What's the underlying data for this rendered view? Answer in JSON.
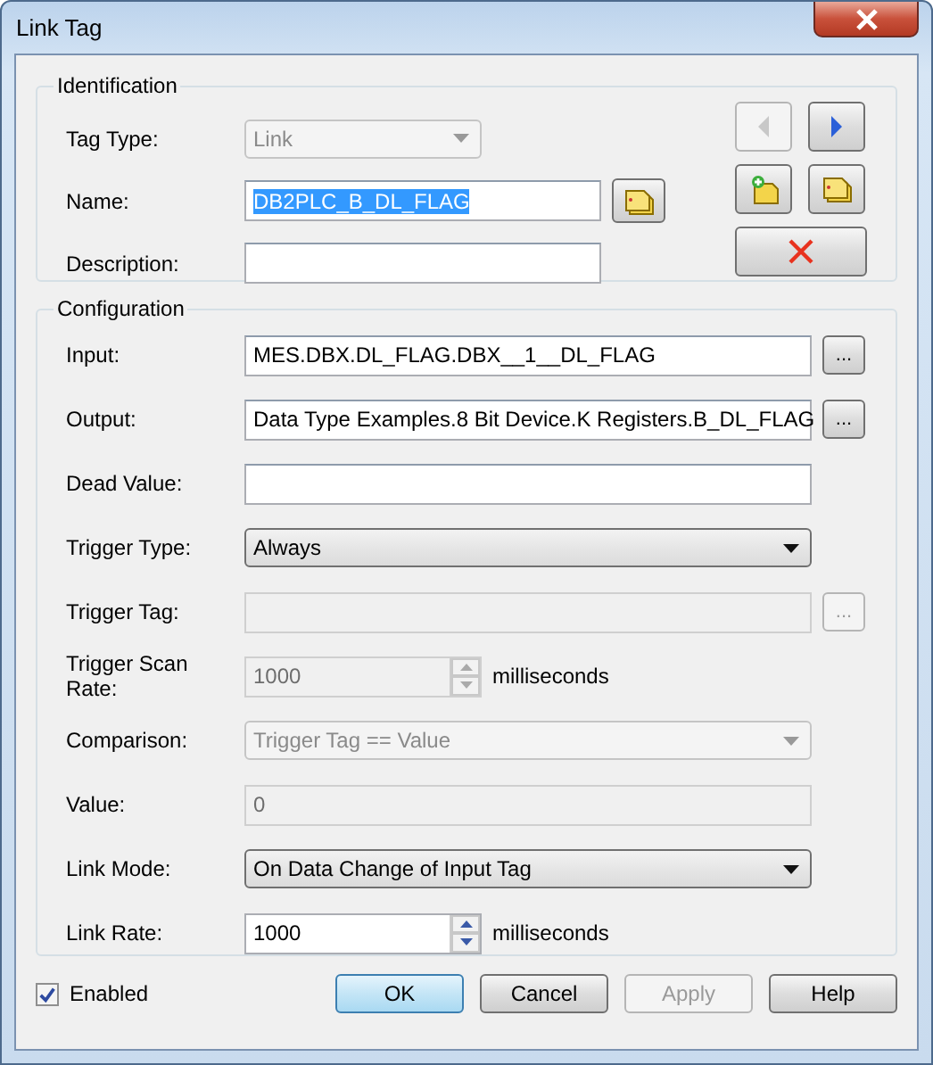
{
  "window": {
    "title": "Link Tag"
  },
  "identification": {
    "legend": "Identification",
    "tag_type": {
      "label": "Tag Type:",
      "value": "Link",
      "disabled": true
    },
    "name": {
      "label": "Name:",
      "value": "DB2PLC_B_DL_FLAG",
      "text_selected": true
    },
    "description": {
      "label": "Description:"
    },
    "nav_buttons": [
      {
        "kind": "prev",
        "disabled": true
      },
      {
        "kind": "next",
        "disabled": false
      },
      {
        "kind": "new",
        "disabled": false
      },
      {
        "kind": "copy",
        "disabled": false
      },
      {
        "kind": "delete",
        "disabled": false
      }
    ]
  },
  "configuration": {
    "legend": "Configuration",
    "rows": [
      {
        "kind": "browse",
        "label": "Input:",
        "value": "MES.DBX.DL_FLAG.DBX__1__DL_FLAG",
        "disabled": false,
        "button": "..."
      },
      {
        "kind": "browse",
        "label": "Output:",
        "value": "Data Type Examples.8 Bit Device.K Registers.B_DL_FLAG",
        "disabled": false,
        "button": "..."
      },
      {
        "kind": "text",
        "label": "Dead Value:",
        "disabled": false
      },
      {
        "kind": "select",
        "label": "Trigger Type:",
        "value": "Always",
        "disabled": false
      },
      {
        "kind": "browse",
        "label": "Trigger Tag:",
        "disabled": true,
        "button": "..."
      },
      {
        "kind": "spin",
        "label": "Trigger Scan Rate:",
        "value": "1000",
        "disabled": true,
        "unit": "milliseconds"
      },
      {
        "kind": "select",
        "label": "Comparison:",
        "value": "Trigger Tag == Value",
        "disabled": true
      },
      {
        "kind": "text",
        "label": "Value:",
        "value": "0",
        "disabled": true
      },
      {
        "kind": "select",
        "label": "Link Mode:",
        "value": "On Data Change of Input Tag",
        "disabled": false
      },
      {
        "kind": "spin",
        "label": "Link Rate:",
        "value": "1000",
        "disabled": false,
        "unit": "milliseconds"
      }
    ]
  },
  "enabled": {
    "label": "Enabled",
    "checked": true
  },
  "buttons": [
    {
      "label": "OK",
      "default": true,
      "disabled": false
    },
    {
      "label": "Cancel",
      "default": false,
      "disabled": false
    },
    {
      "label": "Apply",
      "default": false,
      "disabled": true
    },
    {
      "label": "Help",
      "default": false,
      "disabled": false
    }
  ]
}
